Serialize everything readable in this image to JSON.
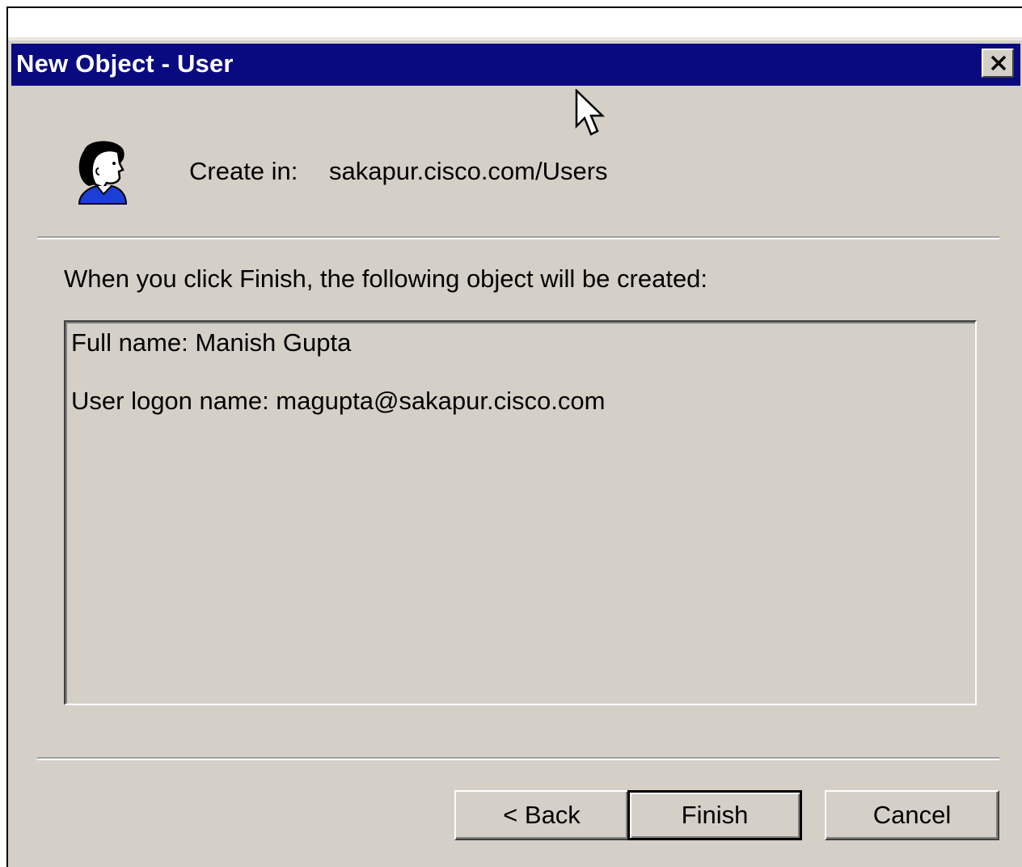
{
  "window": {
    "title": "New Object - User",
    "close_label": "close"
  },
  "header": {
    "create_in_label": "Create in:",
    "create_in_value": "sakapur.cisco.com/Users",
    "icon": "user-icon"
  },
  "main": {
    "info_text": "When you click Finish, the following object will be created:",
    "summary": {
      "full_name_line": "Full name: Manish Gupta",
      "logon_line": "User logon name: magupta@sakapur.cisco.com"
    }
  },
  "buttons": {
    "back": "< Back",
    "finish": "Finish",
    "cancel": "Cancel"
  },
  "colors": {
    "titlebar": "#0a0a80",
    "dialog_face": "#d4d0c8",
    "title_text": "#ffffff"
  }
}
